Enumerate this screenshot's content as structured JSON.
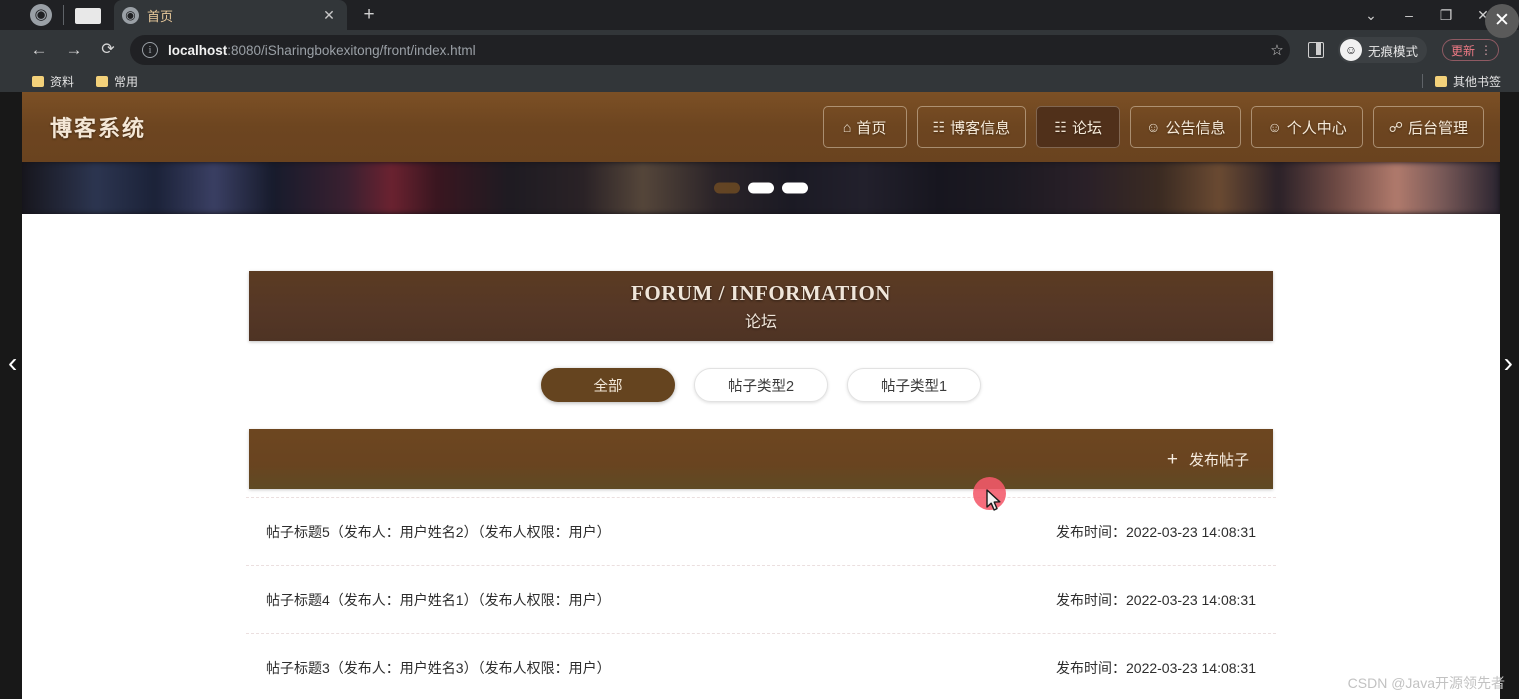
{
  "browser": {
    "window_controls": {
      "chevron": "⌄",
      "minimize": "–",
      "maximize": "❐",
      "close": "✕"
    },
    "tab": {
      "title": "首页",
      "favicon": "globe-icon",
      "close_label": "✕",
      "new_tab_label": "+"
    },
    "nav": {
      "back": "←",
      "forward": "→",
      "reload": "⟳"
    },
    "url": {
      "info_icon": "i",
      "host": "localhost",
      "rest": ":8080/iSharingbokexitong/front/index.html",
      "full": "localhost:8080/iSharingbokexitong/front/index.html"
    },
    "toolbar": {
      "star_label": "☆",
      "side_panel_label": "side-panel",
      "incognito_label": "无痕模式",
      "update_label": "更新",
      "menu_label": "⋮"
    },
    "bookmarks": {
      "items": [
        {
          "label": "资料"
        },
        {
          "label": "常用"
        }
      ],
      "other": {
        "label": "其他书签"
      }
    },
    "overlay_close_label": "✕"
  },
  "site": {
    "brand": "博客系统",
    "nav_items": [
      {
        "label": "首页",
        "icon": "⌂",
        "icon_name": "home-icon",
        "active": false
      },
      {
        "label": "博客信息",
        "icon": "☷",
        "icon_name": "book-icon",
        "active": false
      },
      {
        "label": "论坛",
        "icon": "☷",
        "icon_name": "forum-grid-icon",
        "active": true
      },
      {
        "label": "公告信息",
        "icon": "☺",
        "icon_name": "announcement-icon",
        "active": false
      },
      {
        "label": "个人中心",
        "icon": "☺",
        "icon_name": "user-icon",
        "active": false
      },
      {
        "label": "后台管理",
        "icon": "☍",
        "icon_name": "link-icon",
        "active": false
      }
    ]
  },
  "carousel": {
    "prev_label": "‹",
    "next_label": "›",
    "dots": [
      {
        "active": false
      },
      {
        "active": true
      },
      {
        "active": true
      }
    ]
  },
  "page_arrows": {
    "left": "‹",
    "right": "›"
  },
  "forum": {
    "banner_en": "FORUM / INFORMATION",
    "banner_cn": "论坛",
    "type_tabs": [
      {
        "label": "全部",
        "active": true
      },
      {
        "label": "帖子类型2",
        "active": false
      },
      {
        "label": "帖子类型1",
        "active": false
      }
    ],
    "publish": {
      "plus": "+",
      "label": "发布帖子"
    },
    "posts": [
      {
        "title": "帖子标题5（发布人：用户姓名2）（发布人权限：用户）",
        "time": "发布时间：2022-03-23 14:08:31"
      },
      {
        "title": "帖子标题4（发布人：用户姓名1）（发布人权限：用户）",
        "time": "发布时间：2022-03-23 14:08:31"
      },
      {
        "title": "帖子标题3（发布人：用户姓名3）（发布人权限：用户）",
        "time": "发布时间：2022-03-23 14:08:31"
      }
    ]
  },
  "watermark": "CSDN @Java开源领先者",
  "colors": {
    "brand_brown": "#6d4620",
    "banner_brown": "#553726",
    "active_tab_brown": "#65441f",
    "chrome_bg": "#323639",
    "tabstrip_bg": "#202124",
    "click_marker": "#f4596a",
    "bookmark_folder": "#f3d17a",
    "update_accent": "#ef7a85"
  }
}
